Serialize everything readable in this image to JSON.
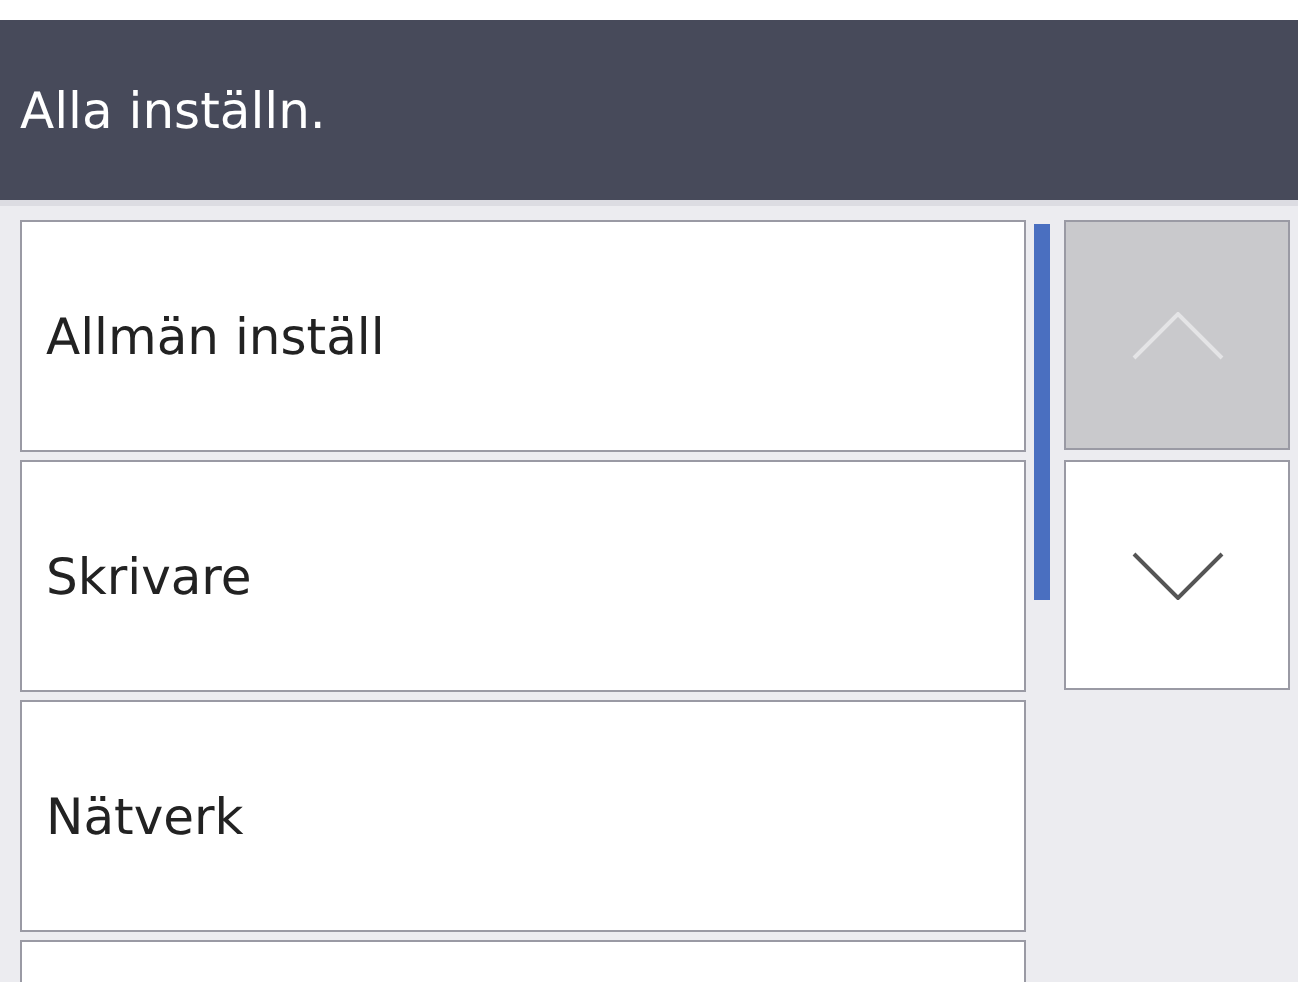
{
  "header": {
    "title": "Alla inställn."
  },
  "menu_items": [
    {
      "label": "Allmän inställ"
    },
    {
      "label": "Skrivare"
    },
    {
      "label": "Nätverk"
    }
  ],
  "scroll_buttons": [
    {
      "kind": "up",
      "disabled": true
    },
    {
      "kind": "down",
      "disabled": false
    }
  ]
}
